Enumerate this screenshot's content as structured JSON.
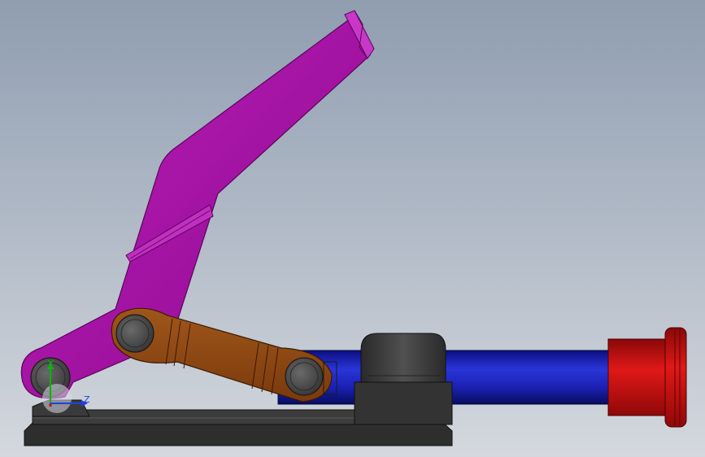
{
  "viewport": {
    "background_top": "#8f9db0",
    "background_bottom": "#d4d8de"
  },
  "triad": {
    "y_label": "Y",
    "z_label": "Z",
    "x_color": "#d01010",
    "y_color": "#10b010",
    "z_color": "#2040e0"
  },
  "parts": {
    "handle": {
      "name": "handle",
      "color": "#a010a0"
    },
    "link": {
      "name": "link",
      "color": "#8b4513"
    },
    "base": {
      "name": "base",
      "color": "#3a3a3a"
    },
    "plunger_rod": {
      "name": "plunger-rod",
      "color": "#1a20b0"
    },
    "plunger_cap": {
      "name": "plunger-cap",
      "color": "#c81010"
    },
    "pivot_pins": {
      "color": "#4a4a4a"
    }
  }
}
